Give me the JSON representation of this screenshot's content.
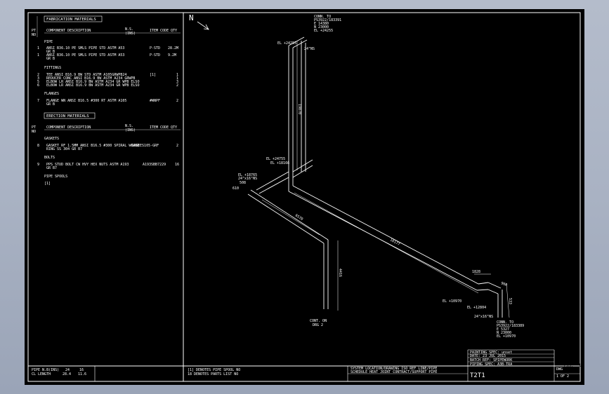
{
  "materials_left": {
    "fabrication_header": "FABRICATION MATERIALS",
    "col_pt": "PT",
    "col_no": "NO",
    "col_desc": "COMPONENT DESCRIPTION",
    "col_ns": "N.S.",
    "col_ins": "(INS)",
    "col_code": "ITEM CODE",
    "col_qty": "QTY",
    "sec_pipe": "PIPE",
    "pipe_rows": [
      {
        "pt": "1",
        "desc": "ANSI B36.10 PE SMLS PIPE STD ASTM A53",
        "desc2": "GR B",
        "code": "P-STD",
        "qty": "28.2M"
      },
      {
        "pt": "1",
        "desc": "ANSI B36.10 PE SMLS PIPE STD ASTM A53",
        "desc2": "GR B",
        "code": "P-STD",
        "qty": "9.2M"
      }
    ],
    "sec_fittings": "FITTINGS",
    "fitting_rows": [
      {
        "pt": "2",
        "desc": "TEE ANSI B16.9 BW STD ASTM A105GRWPB24",
        "code": "[1]",
        "qty": "1"
      },
      {
        "pt": "3",
        "desc": "REDUCER CONC ANSI B16.9 BW ASTM A234 GRWPB",
        "code": "",
        "qty": "1"
      },
      {
        "pt": "5",
        "desc": "ELBOW LR ANSI B16.9 BW ASTM A234 GR WPB ELSO",
        "code": "",
        "qty": "3"
      },
      {
        "pt": "6",
        "desc": "ELBOW LR ANSI B16.9 BW ASTM A234 GR WPB ELSO",
        "code": "",
        "qty": "2"
      }
    ],
    "sec_flanges": "FLANGES",
    "flange_rows": [
      {
        "pt": "7",
        "desc": "FLANGE WN ANSI B16.5 #300 RT ASTM A105",
        "desc2": "GR B",
        "code": "#WNPF",
        "qty": "2"
      }
    ],
    "erection_header": "ERECTION MATERIALS",
    "sec_gaskets": "GASKETS",
    "gasket_rows": [
      {
        "pt": "8",
        "desc": "GASKET RF 1.5MM ANSI B16.5 #300 SPIRAL WOUND",
        "desc2": "RING SS 304 GR B7",
        "code": "GASEES105-GRF",
        "qty": "2"
      }
    ],
    "sec_bolts": "BOLTS",
    "bolt_rows": [
      {
        "pt": "9",
        "desc": "PPS STUD BOLT CW HVY HEX NUTS ASTM A193",
        "desc2": "GR B7",
        "code": "A193SBB7229",
        "qty": "16"
      }
    ],
    "sec_spools": "PIPE SPOOLS",
    "spool_rows": [
      "[1]"
    ],
    "footer_ns_label": "PIPE N.B(INS)",
    "footer_ns_val1": "24",
    "footer_ns_val2": "16",
    "footer_len_label": "CL LENGTH",
    "footer_len_val1": "28.4",
    "footer_len_val2": "11.6"
  },
  "drawing": {
    "north": "N",
    "conn_top": {
      "l1": "CONN. TO",
      "l2": "PS3922/183391",
      "l3": "E 14380",
      "l4": "N 23000",
      "l5": "EL +24255"
    },
    "conn_bottom_right": {
      "l1": "CONN. TO",
      "l2": "PS3922/183389",
      "l3": "E 5327",
      "l4": "N 23000",
      "l5": "EL +10970"
    },
    "conn_bottom_left": {
      "l1": "CONT. ON",
      "l2": "DRG 2"
    },
    "dims": {
      "vert_main": "19870",
      "diag_main": "18177",
      "diag_left": "6570",
      "vert_left": "4416",
      "d508": "508",
      "d610": "610",
      "d1828": "1828",
      "d533": "533",
      "d960": "960"
    },
    "elevations": {
      "top": "EL +24255",
      "top_ns": "24\"NS",
      "mid_a": "EL +24755",
      "mid_b": "EL +18166",
      "left": "EL +18765",
      "left2": "24\"x16\"NS",
      "br_a": "EL +10970",
      "br_b": "EL +12804",
      "br_ns": "24\"x16\"NS"
    },
    "ref_notes": {
      "a": "[1] DENOTES PIPE SPOOL NO",
      "b": "18 DENOTES PARTS LIST NO"
    }
  },
  "title_block": {
    "painting": "PAINTING SPEC: unset",
    "date": "DATE: 23 JUL 2015",
    "batch": "BATCH REF: SPIPEWORK",
    "piping_spec": "PIPING SPEC: A3B-TRA",
    "headers": "SYSTEM LOCATION/DRAWING  ISO  REF  LINE/PIPE",
    "headers2": "SCHEDULE  HEAT  JOINT  CONTRACT/SUPPORT  PIPE",
    "iso": "T2T1",
    "dwg": "DWG",
    "sheet": "1 OF 2",
    "iss": "ISS: -1"
  }
}
